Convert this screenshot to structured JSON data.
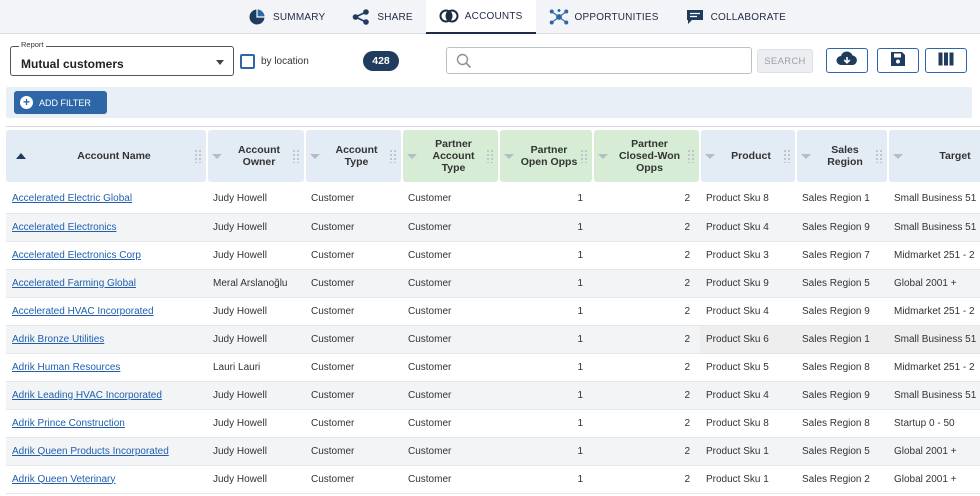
{
  "nav": {
    "tabs": [
      {
        "label": "SUMMARY",
        "icon": "pie-chart-icon"
      },
      {
        "label": "SHARE",
        "icon": "share-icon"
      },
      {
        "label": "ACCOUNTS",
        "icon": "overlap-circles-icon"
      },
      {
        "label": "OPPORTUNITIES",
        "icon": "network-icon"
      },
      {
        "label": "COLLABORATE",
        "icon": "chat-bubble-icon"
      }
    ],
    "active_tab": "ACCOUNTS"
  },
  "toolbar": {
    "report_legend": "Report",
    "report_value": "Mutual customers",
    "by_location_label": "by location",
    "by_location_checked": false,
    "count": "428",
    "search_placeholder": "",
    "search_button": "SEARCH",
    "icons": [
      "cloud-download-icon",
      "save-icon",
      "columns-icon"
    ],
    "add_filter_label": "ADD FILTER"
  },
  "colors": {
    "accent": "#2e67a8",
    "badge": "#1f3b5d",
    "partner_header": "#d7ecd5",
    "header": "#e3ebf5"
  },
  "table": {
    "columns": [
      {
        "label": "Account Name",
        "sort": "asc",
        "group": "blue"
      },
      {
        "label": "Account Owner",
        "group": "blue"
      },
      {
        "label": "Account Type",
        "group": "blue"
      },
      {
        "label": "Partner Account Type",
        "group": "green"
      },
      {
        "label": "Partner Open Opps",
        "group": "green"
      },
      {
        "label": "Partner Closed-Won Opps",
        "group": "green"
      },
      {
        "label": "Product",
        "group": "blue"
      },
      {
        "label": "Sales Region",
        "group": "blue"
      },
      {
        "label": "Target",
        "group": "blue"
      }
    ],
    "rows": [
      [
        "Accelerated Electric Global",
        "Judy Howell",
        "Customer",
        "Customer",
        "1",
        "2",
        "Product Sku 8",
        "Sales Region 1",
        "Small Business 51"
      ],
      [
        "Accelerated Electronics",
        "Judy Howell",
        "Customer",
        "Customer",
        "1",
        "2",
        "Product Sku 4",
        "Sales Region 9",
        "Small Business 51"
      ],
      [
        "Accelerated Electronics Corp",
        "Judy Howell",
        "Customer",
        "Customer",
        "1",
        "2",
        "Product Sku 3",
        "Sales Region 7",
        "Midmarket 251 - 2"
      ],
      [
        "Accelerated Farming Global",
        "Meral Arslanoğlu",
        "Customer",
        "Customer",
        "1",
        "2",
        "Product Sku 9",
        "Sales Region 5",
        "Global 2001 +"
      ],
      [
        "Accelerated HVAC Incorporated",
        "Judy Howell",
        "Customer",
        "Customer",
        "1",
        "2",
        "Product Sku 4",
        "Sales Region 9",
        "Midmarket 251 - 2"
      ],
      [
        "Adrik Bronze Utilities",
        "Judy Howell",
        "Customer",
        "Customer",
        "1",
        "2",
        "Product Sku 6",
        "Sales Region 1",
        "Small Business 51"
      ],
      [
        "Adrik Human Resources",
        "Lauri Lauri",
        "Customer",
        "Customer",
        "1",
        "2",
        "Product Sku 5",
        "Sales Region 8",
        "Midmarket 251 - 2"
      ],
      [
        "Adrik Leading HVAC Incorporated",
        "Judy Howell",
        "Customer",
        "Customer",
        "1",
        "2",
        "Product Sku 4",
        "Sales Region 9",
        "Small Business 51"
      ],
      [
        "Adrik Prince Construction",
        "Judy Howell",
        "Customer",
        "Customer",
        "1",
        "2",
        "Product Sku 8",
        "Sales Region 8",
        "Startup 0 - 50"
      ],
      [
        "Adrik Queen Products Incorporated",
        "Judy Howell",
        "Customer",
        "Customer",
        "1",
        "2",
        "Product Sku 1",
        "Sales Region 5",
        "Global 2001 +"
      ],
      [
        "Adrik Queen Veterinary",
        "Judy Howell",
        "Customer",
        "Customer",
        "1",
        "2",
        "Product Sku 1",
        "Sales Region 2",
        "Global 2001 +"
      ]
    ],
    "highlighted_row": 5
  }
}
